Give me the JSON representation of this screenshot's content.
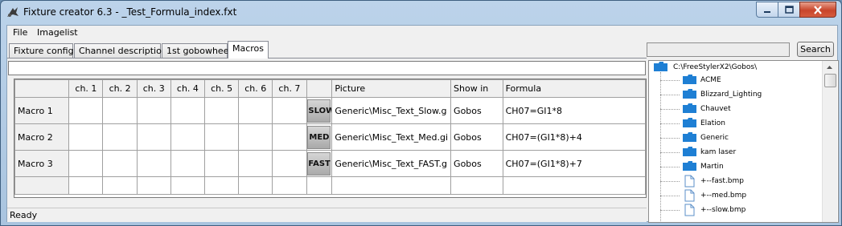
{
  "window": {
    "title": "Fixture creator 6.3 - _Test_Formula_index.fxt"
  },
  "menu": [
    "File",
    "Imagelist"
  ],
  "tabs": [
    "Fixture config.",
    "Channel description",
    "1st gobowheel",
    "Macros"
  ],
  "active_tab": "Macros",
  "grid": {
    "columns": [
      "",
      "ch. 1",
      "ch. 2",
      "ch. 3",
      "ch. 4",
      "ch. 5",
      "ch. 6",
      "ch. 7",
      "",
      "Picture",
      "Show in",
      "Formula"
    ],
    "rows": [
      {
        "name": "Macro 1",
        "thumb": "SLOW",
        "picture": "Generic\\Misc_Text_Slow.g",
        "show_in": "Gobos",
        "formula": "CH07=GI1*8"
      },
      {
        "name": "Macro 2",
        "thumb": "MED",
        "picture": "Generic\\Misc_Text_Med.gi",
        "show_in": "Gobos",
        "formula": "CH07=(GI1*8)+4"
      },
      {
        "name": "Macro 3",
        "thumb": "FAST",
        "picture": "Generic\\Misc_Text_FAST.g",
        "show_in": "Gobos",
        "formula": "CH07=(GI1*8)+7"
      }
    ]
  },
  "status": "Ready",
  "search": {
    "button": "Search",
    "value": ""
  },
  "tree": {
    "root": "C:\\FreeStylerX2\\Gobos\\",
    "folders": [
      "ACME",
      "Blizzard_Lighting",
      "Chauvet",
      "Elation",
      "Generic",
      "kam laser",
      "Martin"
    ],
    "files": [
      "+--fast.bmp",
      "+--med.bmp",
      "+--slow.bmp"
    ]
  },
  "colors": {
    "folder": "#1e7fd4",
    "close_button": "#c8452b"
  }
}
